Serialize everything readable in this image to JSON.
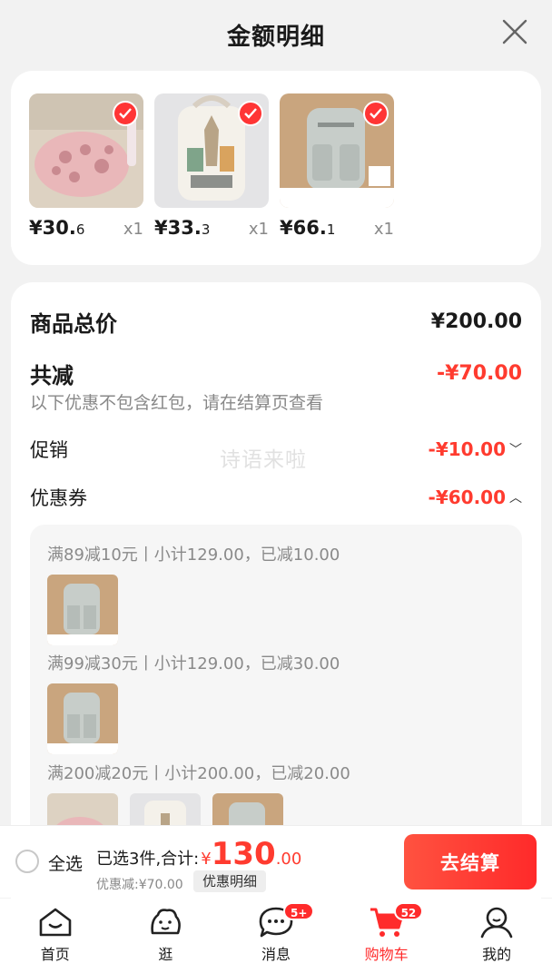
{
  "header": {
    "title": "金额明细"
  },
  "products": [
    {
      "price_int": "¥30.",
      "price_dec": "6",
      "qty": "x1"
    },
    {
      "price_int": "¥33.",
      "price_dec": "3",
      "qty": "x1"
    },
    {
      "price_int": "¥66.",
      "price_dec": "1",
      "qty": "x1"
    }
  ],
  "totals": {
    "goods_total_label": "商品总价",
    "goods_total_value": "¥200.00",
    "discount_label": "共减",
    "discount_value": "-¥70.00",
    "discount_note": "以下优惠不包含红包，请在结算页查看",
    "promo_label": "促销",
    "promo_value": "-¥10.00",
    "coupon_label": "优惠券",
    "coupon_value": "-¥60.00"
  },
  "watermark": "诗语来啦",
  "coupons": [
    {
      "text": "满89减10元丨小计129.00，已减10.00"
    },
    {
      "text": "满99减30元丨小计129.00，已减30.00"
    },
    {
      "text": "满200减20元丨小计200.00，已减20.00"
    }
  ],
  "bottom_bar": {
    "select_all": "全选",
    "summary_prefix": "已选3件,合计:",
    "currency": "¥",
    "total_int": "130",
    "total_dec": ".00",
    "discount_text": "优惠减:¥70.00",
    "detail_tag": "优惠明细",
    "checkout": "去结算"
  },
  "tabbar": [
    {
      "label": "首页",
      "icon": "home-icon"
    },
    {
      "label": "逛",
      "icon": "explore-icon"
    },
    {
      "label": "消息",
      "icon": "message-icon",
      "badge": "5+"
    },
    {
      "label": "购物车",
      "icon": "cart-icon",
      "badge": "52",
      "active": true
    },
    {
      "label": "我的",
      "icon": "profile-icon"
    }
  ],
  "colors": {
    "accent": "#ff3b2f",
    "background": "#f2f2f2"
  }
}
